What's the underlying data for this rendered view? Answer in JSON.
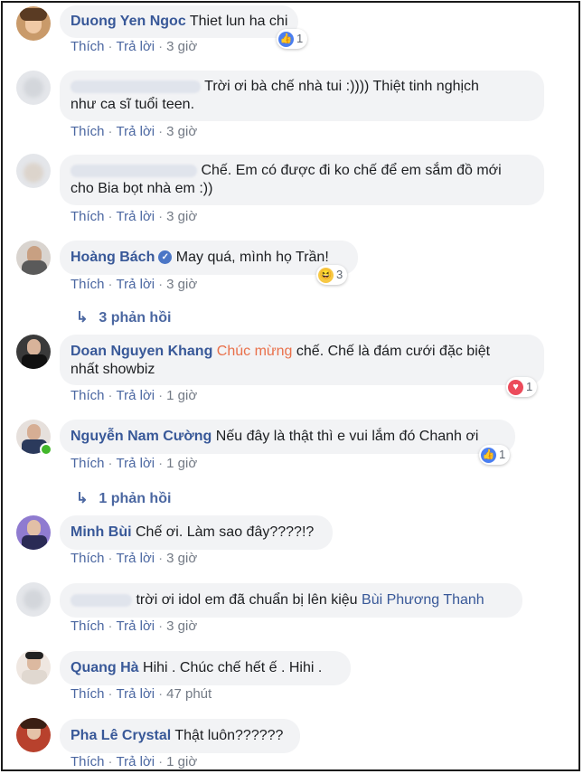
{
  "labels": {
    "like": "Thích",
    "reply": "Trả lời",
    "sep": "·"
  },
  "comments": [
    {
      "name": "Duong Yen Ngoc",
      "text": "Thiet lun ha chi",
      "time": "3 giờ",
      "reaction": {
        "type": "like",
        "count": "1"
      }
    },
    {
      "text": "Trời ơi bà chế nhà tui :)))) Thiệt tinh nghịch",
      "text2": "như ca sĩ tuổi teen.",
      "time": "3 giờ"
    },
    {
      "text": "Chế. Em có được đi ko chế để em sắm đồ mới",
      "text2": "cho Bia bọt nhà em :))",
      "time": "3 giờ"
    },
    {
      "name": "Hoàng Bách",
      "verified": true,
      "text": "May quá, mình họ Trần!",
      "time": "3 giờ",
      "reaction": {
        "type": "haha",
        "count": "3"
      }
    },
    {
      "name": "Doan Nguyen Khang",
      "mention": "Chúc mừng",
      "text": "chế. Chế là đám cưới đặc biệt",
      "text2": "nhất showbiz",
      "time": "1 giờ",
      "reaction": {
        "type": "love",
        "count": "1"
      }
    },
    {
      "name": "Nguyễn Nam Cường",
      "text": "Nếu đây là thật thì e vui lắm đó Chanh ơi",
      "time": "1 giờ",
      "reaction": {
        "type": "like",
        "count": "1"
      }
    },
    {
      "name": "Minh Bùi",
      "text": "Chế ơi. Làm sao đây????!?",
      "time": "3 giờ"
    },
    {
      "text": "trời ơi idol em đã chuẩn bị lên kiệu",
      "tag": "Bùi Phương Thanh",
      "time": "3 giờ"
    },
    {
      "name": "Quang Hà",
      "text": "Hihi . Chúc chế hết ế . Hihi .",
      "time": "47 phút"
    },
    {
      "name": "Pha Lê Crystal",
      "text": "Thật luôn??????",
      "time": "1 giờ"
    }
  ],
  "replies": [
    {
      "label": "3 phản hồi"
    },
    {
      "label": "1 phản hồi"
    }
  ]
}
